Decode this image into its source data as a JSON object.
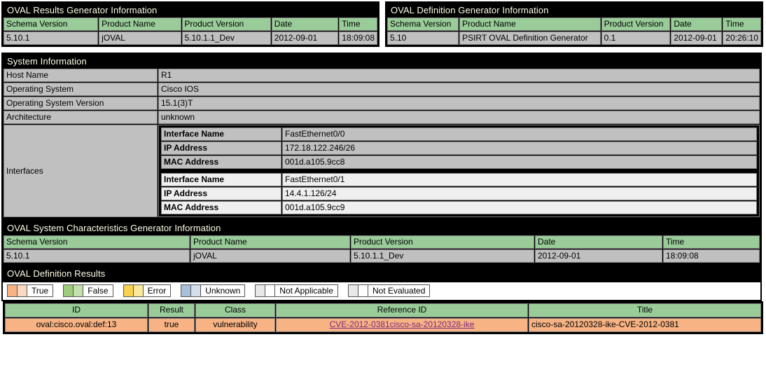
{
  "results_generator": {
    "title": "OVAL Results Generator Information",
    "headers": [
      "Schema Version",
      "Product Name",
      "Product Version",
      "Date",
      "Time"
    ],
    "values": [
      "5.10.1",
      "jOVAL",
      "5.10.1.1_Dev",
      "2012-09-01",
      "18:09:08"
    ]
  },
  "definition_generator": {
    "title": "OVAL Definition Generator Information",
    "headers": [
      "Schema Version",
      "Product Name",
      "Product Version",
      "Date",
      "Time"
    ],
    "values": [
      "5.10",
      "PSIRT OVAL Definition Generator",
      "0.1",
      "2012-09-01",
      "20:26:10"
    ]
  },
  "system_information": {
    "title": "System Information",
    "rows": [
      {
        "label": "Host Name",
        "value": "R1"
      },
      {
        "label": "Operating System",
        "value": "Cisco IOS"
      },
      {
        "label": "Operating System Version",
        "value": "15.1(3)T"
      },
      {
        "label": "Architecture",
        "value": "unknown"
      }
    ],
    "interfaces_label": "Interfaces",
    "interfaces": [
      {
        "name_label": "Interface Name",
        "name_value": "FastEthernet0/0",
        "ip_label": "IP Address",
        "ip_value": "172.18.122.246/26",
        "mac_label": "MAC Address",
        "mac_value": "001d.a105.9cc8"
      },
      {
        "name_label": "Interface Name",
        "name_value": "FastEthernet0/1",
        "ip_label": "IP Address",
        "ip_value": "14.4.1.126/24",
        "mac_label": "MAC Address",
        "mac_value": "001d.a105.9cc9"
      }
    ]
  },
  "system_characteristics": {
    "title": "OVAL System Characteristics Generator Information",
    "headers": [
      "Schema Version",
      "Product Name",
      "Product Version",
      "Date",
      "Time"
    ],
    "values": [
      "5.10.1",
      "jOVAL",
      "5.10.1.1_Dev",
      "2012-09-01",
      "18:09:08"
    ]
  },
  "definition_results": {
    "title": "OVAL Definition Results",
    "legend": [
      {
        "label": "True",
        "color1": "#f7b383",
        "color2": "#fbd9c0"
      },
      {
        "label": "False",
        "color1": "#9ecb7c",
        "color2": "#c4e0ae"
      },
      {
        "label": "Error",
        "color1": "#f7d14f",
        "color2": "#fbe89c"
      },
      {
        "label": "Unknown",
        "color1": "#a8c0d8",
        "color2": "#d3e0ec"
      },
      {
        "label": "Not Applicable",
        "color1": "#e8e8e8",
        "color2": "#ffffff"
      },
      {
        "label": "Not Evaluated",
        "color1": "#e8e8e8",
        "color2": "#ffffff"
      }
    ],
    "headers": [
      "ID",
      "Result",
      "Class",
      "Reference ID",
      "Title"
    ],
    "rows": [
      {
        "id": "oval:cisco.oval:def:13",
        "result": "true",
        "class": "vulnerability",
        "reference_id": "CVE-2012-0381cisco-sa-20120328-ike",
        "title": "cisco-sa-20120328-ike-CVE-2012-0381"
      }
    ]
  },
  "colors": {
    "header_green": "#99cc99",
    "cell_gray": "#c0c0c0",
    "true_orange": "#f7b383",
    "section_bar": "#000000",
    "section_text": "#fffde8",
    "link": "#7f2a7f"
  }
}
